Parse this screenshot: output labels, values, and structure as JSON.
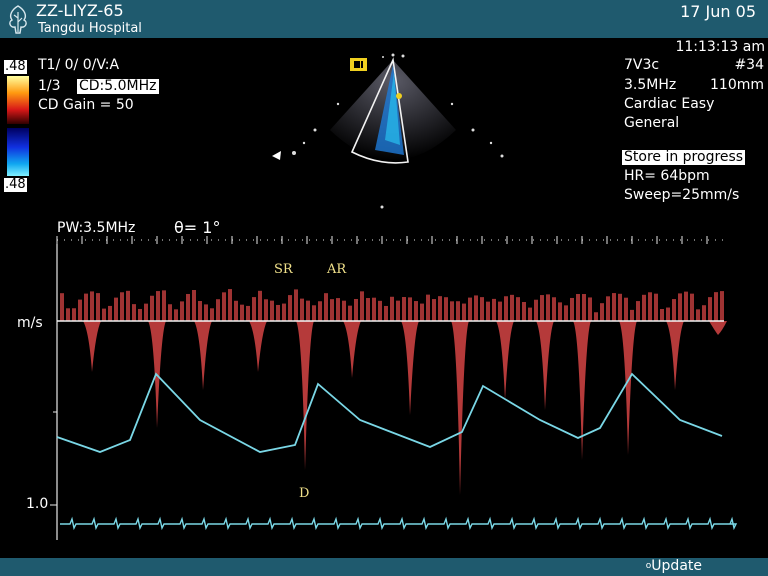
{
  "header": {
    "patient_id": "ZZ-LIYZ-65",
    "hospital": "Tangdu Hospital",
    "date": "17 Jun 05"
  },
  "left_panel": {
    "scale_top": ".48",
    "scale_bottom": ".48",
    "line1": "T1/ 0/ 0/V:A",
    "line2_prefix": "1/3",
    "cd_freq": "CD:5.0MHz",
    "line3": "CD Gain = 50"
  },
  "right_panel": {
    "time": "11:13:13 am",
    "probe": "7V3c",
    "study_num": "#34",
    "freq": "3.5MHz",
    "depth": "110mm",
    "preset": "Cardiac Easy",
    "mode": "General",
    "store_status": "Store in progress",
    "hr": "HR= 64bpm",
    "sweep": "Sweep=25mm/s"
  },
  "doppler": {
    "pw_label": "PW:3.5MHz",
    "angle": "θ= 1°",
    "unit": "m/s",
    "tick_10": "1.0",
    "wave_labels": {
      "sr": "SR",
      "ar": "AR",
      "d": "D"
    }
  },
  "footer": {
    "update": "Update"
  },
  "colors": {
    "header_bg": "#1f5a6e",
    "spectrum": "#e24848",
    "trace": "#7ad7e6",
    "annotation": "#f0e08a"
  },
  "icons": [
    "tree-logo-icon",
    "color-scale-bar",
    "probe-orientation-icon",
    "sector-image"
  ]
}
